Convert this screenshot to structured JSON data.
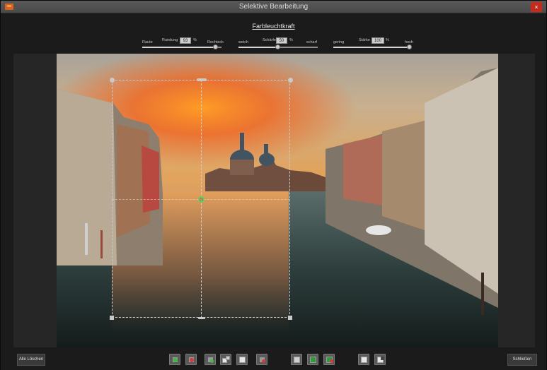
{
  "window": {
    "title": "Selektive Bearbeitung",
    "close_label": "×"
  },
  "heading": "Farbleuchtkraft",
  "controls": {
    "rundung": {
      "left_label": "Raute",
      "name": "Rundung",
      "value": "93",
      "unit": "%",
      "right_label": "Rechteck",
      "level": 0.93
    },
    "schaerfe": {
      "left_label": "weich",
      "name": "Schärfe",
      "value": "50",
      "unit": "%",
      "right_label": "scharf",
      "level": 0.5
    },
    "staerke": {
      "left_label": "gering",
      "name": "Stärke",
      "value": "100",
      "unit": "%",
      "right_label": "hoch",
      "level": 1.0
    }
  },
  "footer": {
    "clear_all_label": "Alle Löschen",
    "close_label": "Schließen"
  },
  "toolbar_icons": [
    "add-green-selection-icon",
    "add-red-selection-icon",
    "edit-selection-icon",
    "copy-selection-icon",
    "paste-selection-icon",
    "delete-selection-icon",
    "mask-view-icon",
    "green-view-icon",
    "overlay-view-icon",
    "save-mask-icon",
    "load-mask-icon"
  ],
  "colors": {
    "accent_green": "#5fcf5f",
    "accent_red": "#d93a3a",
    "close_red": "#c42b1c",
    "app_orange": "#d9631c"
  }
}
